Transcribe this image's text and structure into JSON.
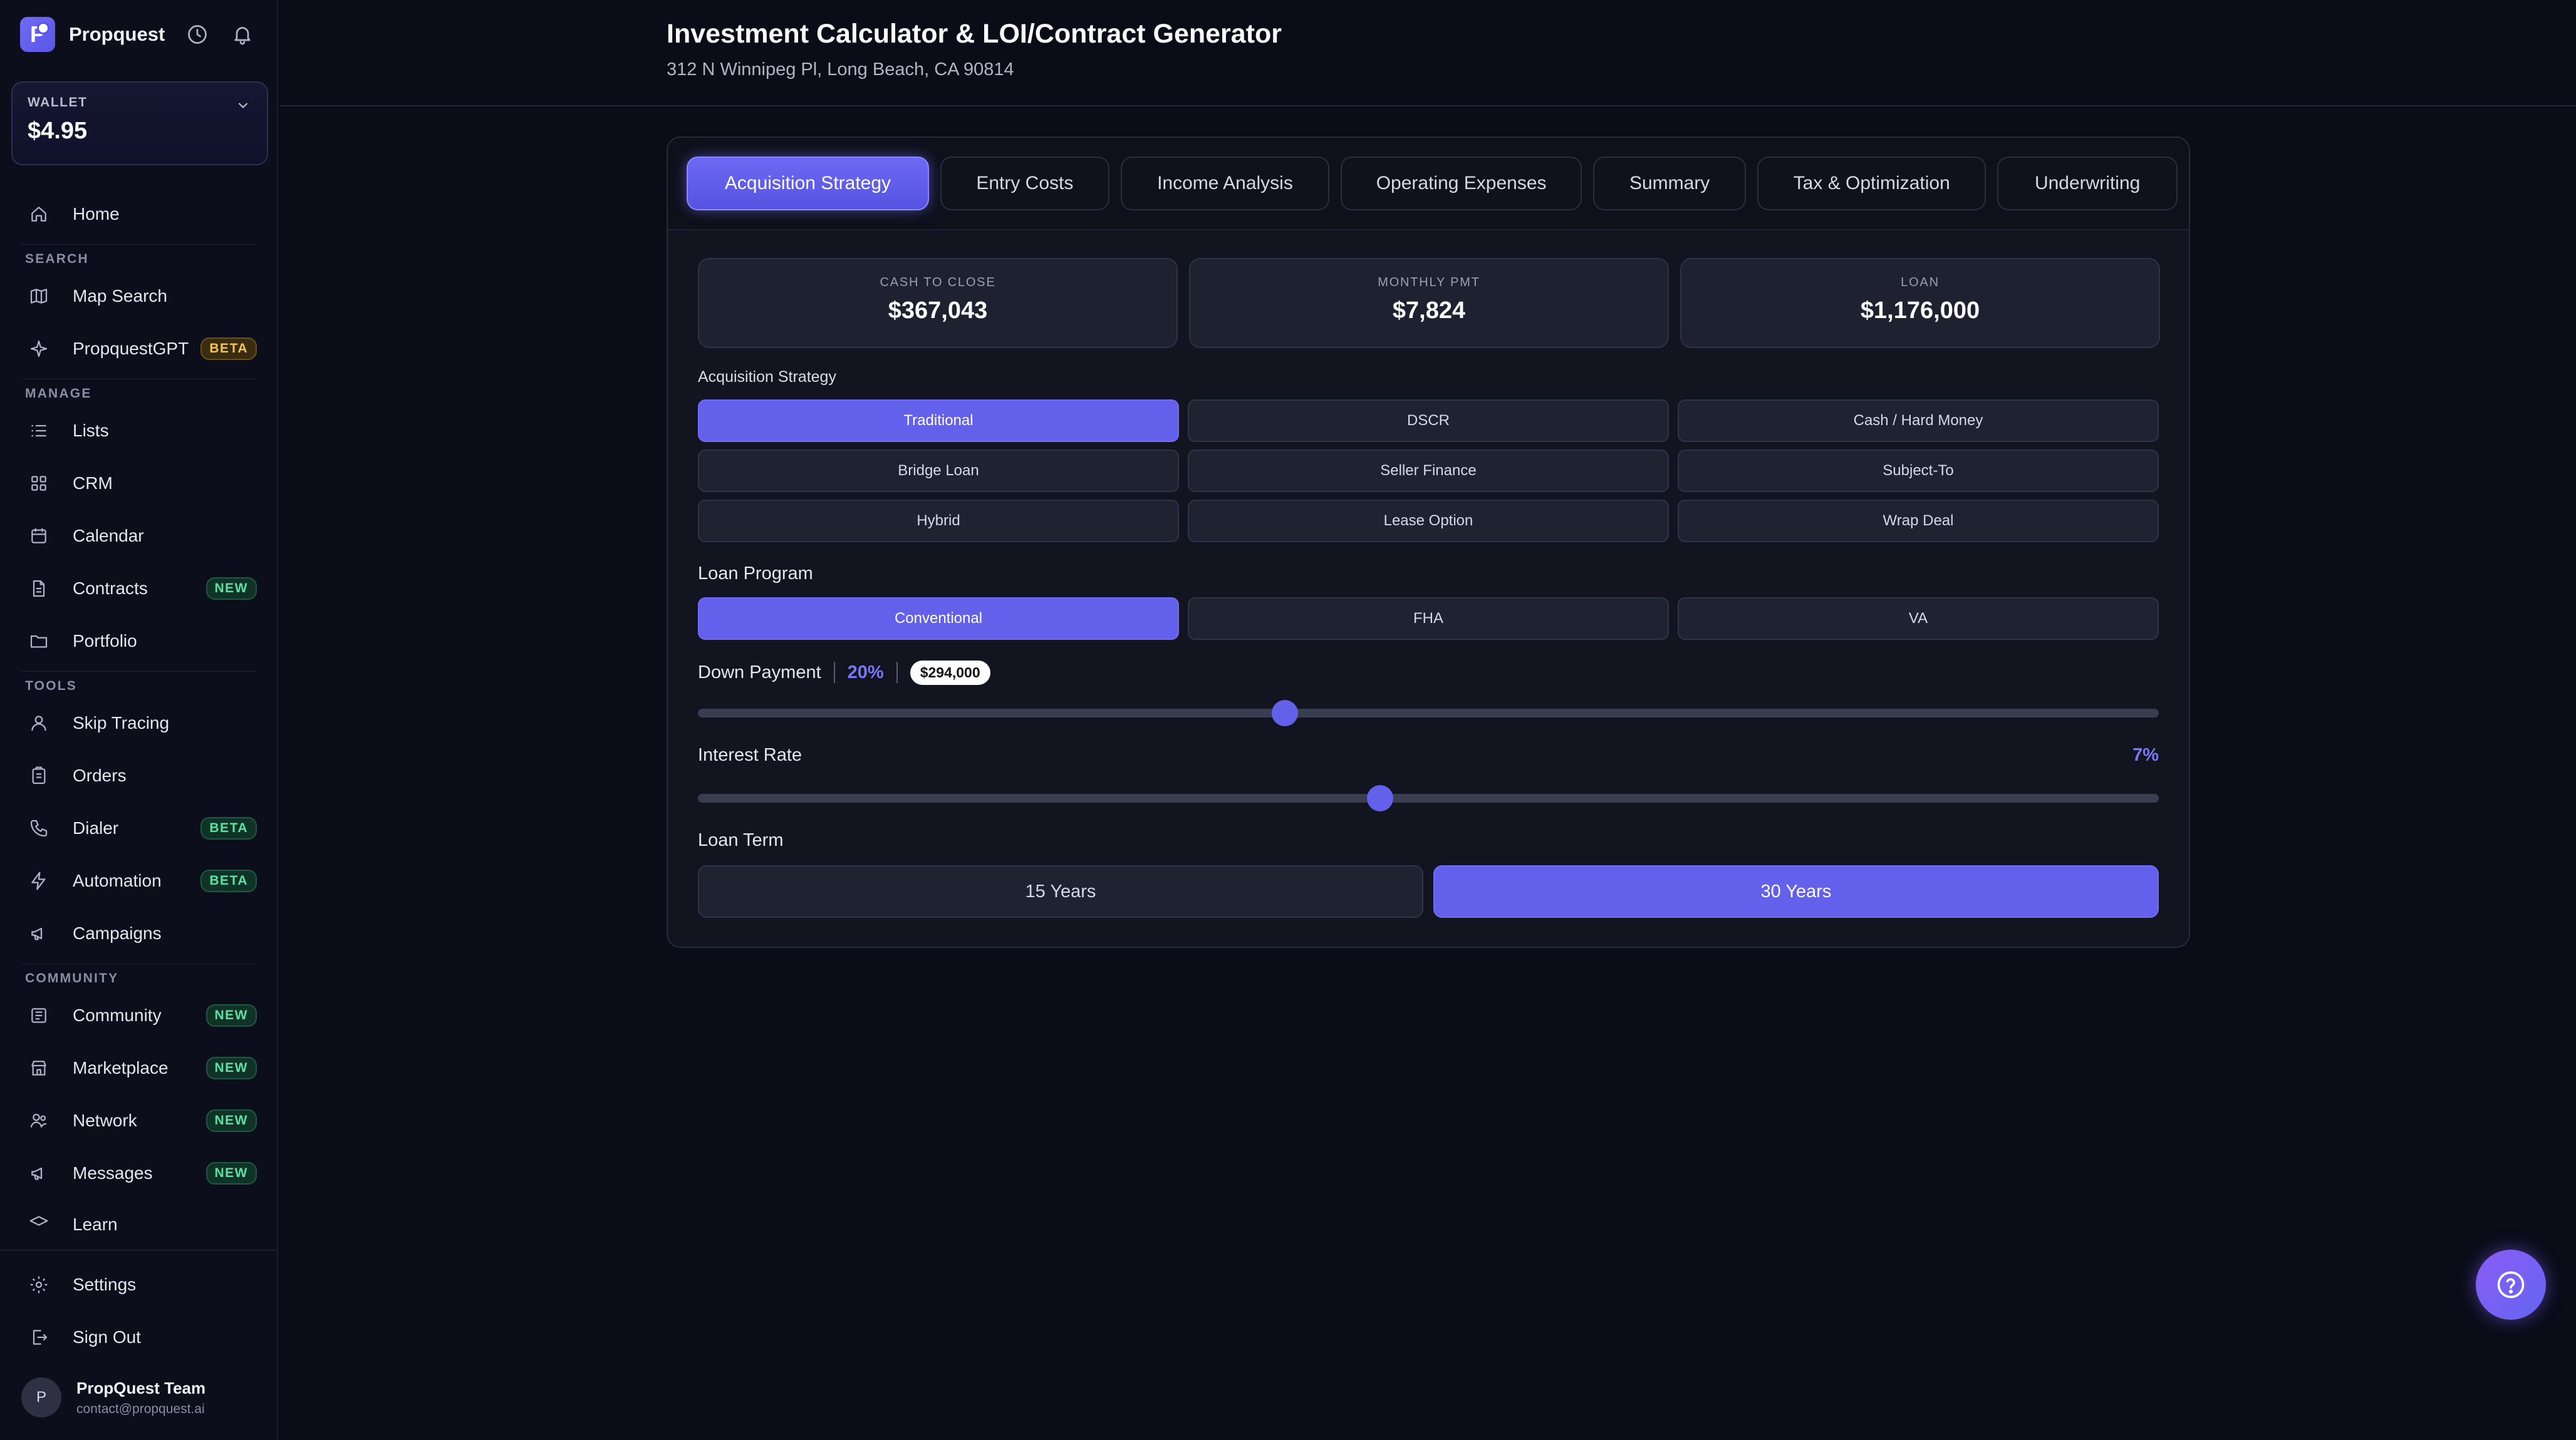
{
  "app": {
    "name": "Propquest",
    "logo_letter": "P"
  },
  "wallet": {
    "label": "WALLET",
    "amount": "$4.95"
  },
  "nav": {
    "home": "Home",
    "search_section": "SEARCH",
    "map_search": "Map Search",
    "propquestgpt": "PropquestGPT",
    "propquestgpt_badge": "BETA",
    "manage_section": "MANAGE",
    "lists": "Lists",
    "crm": "CRM",
    "calendar": "Calendar",
    "contracts": "Contracts",
    "contracts_badge": "NEW",
    "portfolio": "Portfolio",
    "tools_section": "TOOLS",
    "skip_tracing": "Skip Tracing",
    "orders": "Orders",
    "dialer": "Dialer",
    "dialer_badge": "BETA",
    "automation": "Automation",
    "automation_badge": "BETA",
    "campaigns": "Campaigns",
    "community_section": "COMMUNITY",
    "community": "Community",
    "community_badge": "NEW",
    "marketplace": "Marketplace",
    "marketplace_badge": "NEW",
    "network": "Network",
    "network_badge": "NEW",
    "messages": "Messages",
    "messages_badge": "NEW",
    "learn": "Learn",
    "settings": "Settings",
    "sign_out": "Sign Out"
  },
  "user": {
    "initial": "P",
    "name": "PropQuest Team",
    "email": "contact@propquest.ai"
  },
  "page": {
    "title": "Investment Calculator & LOI/Contract Generator",
    "address": "312 N Winnipeg Pl, Long Beach, CA 90814"
  },
  "tabs": [
    {
      "label": "Acquisition Strategy"
    },
    {
      "label": "Entry Costs"
    },
    {
      "label": "Income Analysis"
    },
    {
      "label": "Operating Expenses"
    },
    {
      "label": "Summary"
    },
    {
      "label": "Tax & Optimization"
    },
    {
      "label": "Underwriting"
    }
  ],
  "stats": {
    "cash_to_close": {
      "label": "CASH TO CLOSE",
      "value": "$367,043"
    },
    "monthly_pmt": {
      "label": "MONTHLY PMT",
      "value": "$7,824"
    },
    "loan": {
      "label": "LOAN",
      "value": "$1,176,000"
    }
  },
  "strategy": {
    "label": "Acquisition Strategy",
    "options": [
      "Traditional",
      "DSCR",
      "Cash / Hard Money",
      "Bridge Loan",
      "Seller Finance",
      "Subject-To",
      "Hybrid",
      "Lease Option",
      "Wrap Deal"
    ],
    "selected": "Traditional"
  },
  "loan_program": {
    "label": "Loan Program",
    "options": [
      "Conventional",
      "FHA",
      "VA"
    ],
    "selected": "Conventional"
  },
  "down_payment": {
    "label": "Down Payment",
    "percent": "20%",
    "amount": "$294,000",
    "slider_fraction": 0.402
  },
  "interest_rate": {
    "label": "Interest Rate",
    "value": "7%",
    "slider_fraction": 0.467
  },
  "loan_term": {
    "label": "Loan Term",
    "options": [
      "15 Years",
      "30 Years"
    ],
    "selected": "30 Years"
  },
  "colors": {
    "accent": "#6360ec",
    "accent_text": "#7b78f7",
    "background": "#0a0c18",
    "panel": "#12151f"
  },
  "icons": {
    "help": "question-circle-icon"
  }
}
